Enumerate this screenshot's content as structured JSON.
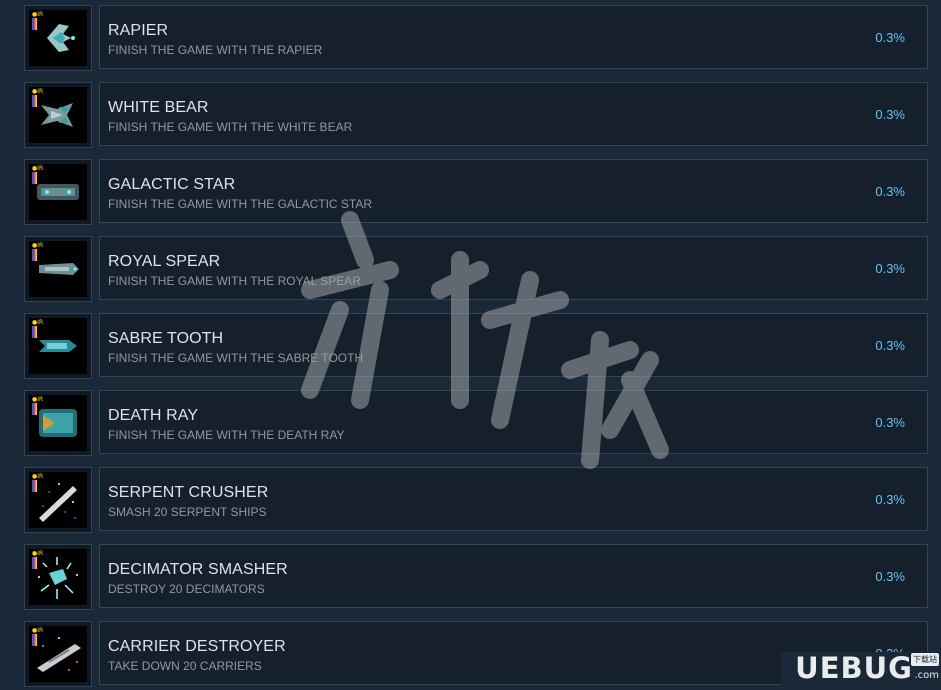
{
  "achievements": [
    {
      "title": "RAPIER",
      "description": "FINISH THE GAME WITH THE RAPIER",
      "percent": "0.3%",
      "icon": "rapier-ship-icon"
    },
    {
      "title": "WHITE BEAR",
      "description": "FINISH THE GAME WITH THE WHITE BEAR",
      "percent": "0.3%",
      "icon": "white-bear-ship-icon"
    },
    {
      "title": "GALACTIC STAR",
      "description": "FINISH THE GAME WITH THE GALACTIC STAR",
      "percent": "0.3%",
      "icon": "galactic-star-ship-icon"
    },
    {
      "title": "ROYAL SPEAR",
      "description": "FINISH THE GAME WITH THE ROYAL SPEAR",
      "percent": "0.3%",
      "icon": "royal-spear-ship-icon"
    },
    {
      "title": "SABRE TOOTH",
      "description": "FINISH THE GAME WITH THE SABRE TOOTH",
      "percent": "0.3%",
      "icon": "sabre-tooth-ship-icon"
    },
    {
      "title": "DEATH RAY",
      "description": "FINISH THE GAME WITH THE DEATH RAY",
      "percent": "0.3%",
      "icon": "death-ray-ship-icon"
    },
    {
      "title": "SERPENT CRUSHER",
      "description": "SMASH 20 SERPENT SHIPS",
      "percent": "0.3%",
      "icon": "serpent-crusher-icon"
    },
    {
      "title": "DECIMATOR SMASHER",
      "description": "DESTROY 20 DECIMATORS",
      "percent": "0.3%",
      "icon": "decimator-smasher-icon"
    },
    {
      "title": "CARRIER DESTROYER",
      "description": "TAKE DOWN 20 CARRIERS",
      "percent": "0.3%",
      "icon": "carrier-destroyer-icon"
    }
  ],
  "watermark": {
    "text": "游侠网"
  },
  "logo": {
    "text": "UEBUG",
    "sub": "下载站",
    "dotcom": ".com"
  },
  "colors": {
    "background": "#1b2838",
    "card": "#16202d",
    "border": "#2a475e",
    "percent": "#66c0f4"
  }
}
